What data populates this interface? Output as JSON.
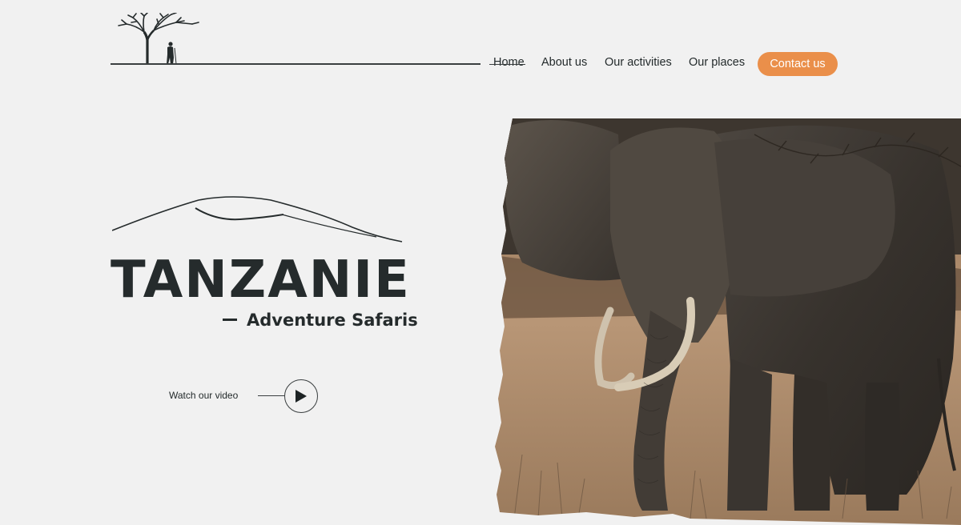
{
  "header": {
    "logo_icon": "acacia-tree-with-person-icon"
  },
  "nav": {
    "items": [
      {
        "label": "Home",
        "active": true
      },
      {
        "label": "About us"
      },
      {
        "label": "Our activities"
      },
      {
        "label": "Our places"
      }
    ],
    "contact_label": "Contact us"
  },
  "hero": {
    "title": "TANZANIE",
    "subtitle": "Adventure Safaris",
    "video_label": "Watch our video",
    "play_icon": "play-icon",
    "mountain_icon": "kilimanjaro-outline-icon",
    "image_subject": "elephant"
  },
  "colors": {
    "background": "#f1f1f1",
    "text": "#252b2c",
    "accent": "#ea8f4a"
  }
}
